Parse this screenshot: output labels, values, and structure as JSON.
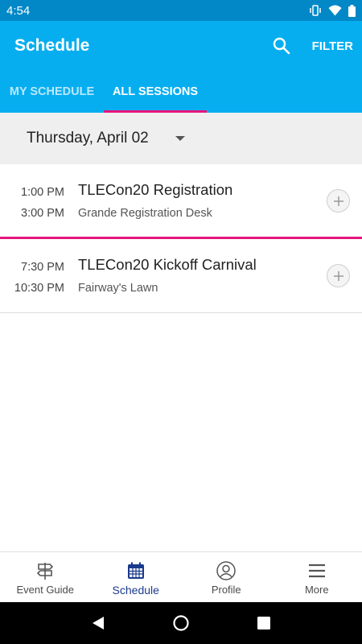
{
  "status_bar": {
    "time": "4:54",
    "icons": [
      "vibrate-icon",
      "wifi-icon",
      "battery-icon"
    ]
  },
  "app_bar": {
    "title": "Schedule",
    "search_icon": "search-icon",
    "filter_label": "FILTER"
  },
  "tabs": [
    {
      "label": "MY SCHEDULE",
      "active": false
    },
    {
      "label": "ALL SESSIONS",
      "active": true
    }
  ],
  "date_selector": {
    "label": "Thursday, April 02",
    "icon": "dropdown-caret-icon"
  },
  "sessions": [
    {
      "start": "1:00 PM",
      "end": "3:00 PM",
      "title": "TLECon20 Registration",
      "location": "Grande Registration Desk"
    },
    {
      "start": "7:30 PM",
      "end": "10:30 PM",
      "title": "TLECon20 Kickoff Carnival",
      "location": "Fairway's Lawn"
    }
  ],
  "bottom_nav": [
    {
      "label": "Event Guide",
      "icon": "signpost-icon",
      "active": false
    },
    {
      "label": "Schedule",
      "icon": "calendar-icon",
      "active": true
    },
    {
      "label": "Profile",
      "icon": "profile-icon",
      "active": false
    },
    {
      "label": "More",
      "icon": "menu-icon",
      "active": false
    }
  ],
  "colors": {
    "app_bar": "#06aef0",
    "status_bar": "#0288c7",
    "accent": "#e4157d",
    "nav_active": "#1a3a8c"
  }
}
